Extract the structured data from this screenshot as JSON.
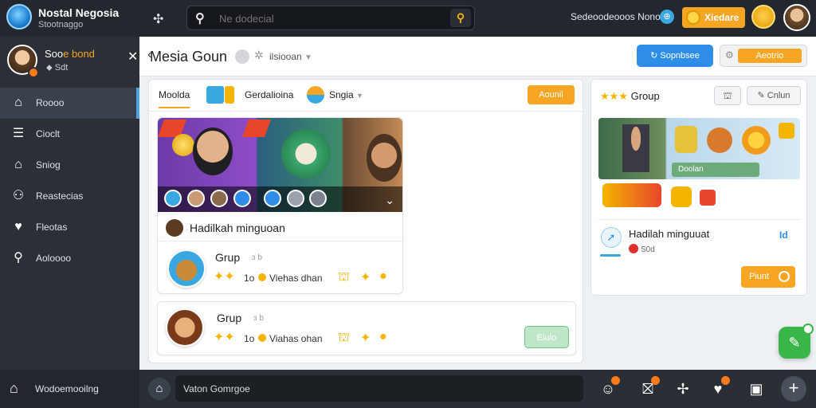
{
  "topbar": {
    "brand_title": "Nostal Negosia",
    "brand_sub": "Stootnaggo",
    "search_placeholder": "Ne dodecial",
    "user_text": "Sedeoodeooos Nono",
    "coin_label": "Xiedare"
  },
  "sidebar": {
    "profile_name_a": "Soo",
    "profile_name_b": "e bond",
    "profile_stat": "Sdt",
    "items": [
      {
        "label": "Roooo",
        "icon": "home-icon"
      },
      {
        "label": "Cioclt",
        "icon": "list-icon"
      },
      {
        "label": "Sniog",
        "icon": "house-icon"
      },
      {
        "label": "Reastecias",
        "icon": "people-icon"
      },
      {
        "label": "Fleotas",
        "icon": "heart-icon"
      },
      {
        "label": "Aoloooo",
        "icon": "search-icon"
      }
    ]
  },
  "main": {
    "title": "Mesia Goun",
    "filter_label": "ilsiooan",
    "btn_blue": "Sopnbsee",
    "btn_orange": "Aeotrio"
  },
  "left_panel": {
    "tabs": [
      "Moolda",
      "Gerdalioina",
      "Sngia"
    ],
    "tab_button": "Aounil",
    "video_caption": "Hadilkah minguoan",
    "groups": [
      {
        "title": "Grup",
        "subtitle": "Viehas dhan",
        "badge_1": "1o",
        "small": "ɜ b"
      },
      {
        "title": "Grup",
        "subtitle": "Viahas ohan",
        "badge_1": "1o",
        "small": "ɜ b"
      }
    ],
    "green_button": "Elulo"
  },
  "right_panel": {
    "title": "Group",
    "btn_2": "Cnlun",
    "green_label": "Doolan",
    "hadiah": "Hadilah minguuat",
    "sub": "S0d",
    "blue_marker": "Id",
    "orange_button": "Piunt"
  },
  "bottom": {
    "home_label": "Wodoemooilng",
    "input_value": "Vaton Gomrgoe"
  }
}
